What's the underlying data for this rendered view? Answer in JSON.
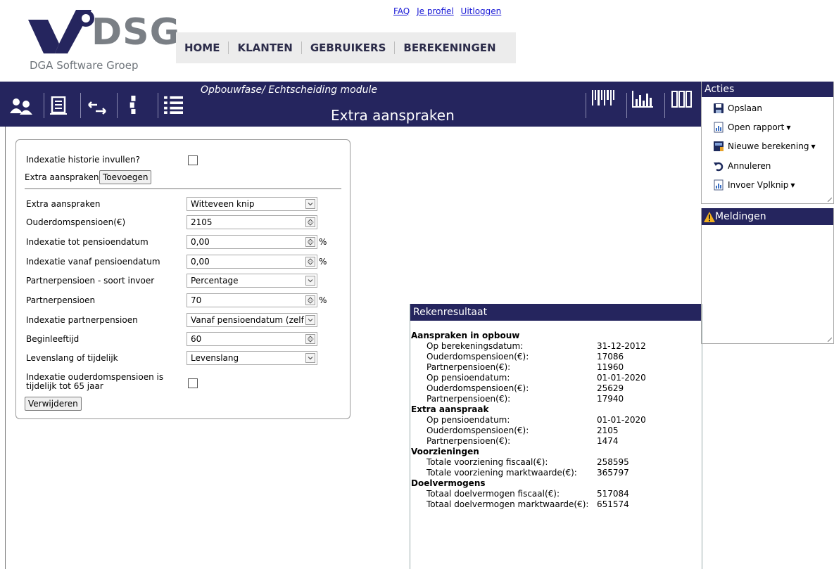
{
  "brand": {
    "logo_text": "DSG",
    "logo_subtitle": "DGA Software Groep"
  },
  "top_links": {
    "faq": "FAQ",
    "profile": "Je profiel",
    "logout": "Uitloggen"
  },
  "nav": {
    "home": "HOME",
    "clients": "KLANTEN",
    "users": "GEBRUIKERS",
    "calculations": "BEREKENINGEN"
  },
  "toolbar": {
    "module_title": "Opbouwfase/ Echtscheiding module",
    "page_title": "Extra aanspraken",
    "icons_left": [
      "users-icon",
      "document-icon",
      "arrows-icon",
      "person-icon",
      "list-icon"
    ],
    "icons_right": [
      "barcode-icon",
      "bar-chart-icon",
      "columns-icon"
    ]
  },
  "form": {
    "indexatie_historie_label": "Indexatie historie invullen?",
    "indexatie_historie_checked": false,
    "extra_aanspraken_heading": "Extra aanspraken",
    "add_button": "Toevoegen",
    "fields": [
      {
        "label": "Extra aanspraken",
        "value": "Witteveen knip",
        "type": "select"
      },
      {
        "label": "Ouderdomspensioen(€)",
        "value": "2105",
        "type": "spinner"
      },
      {
        "label": "Indexatie tot pensioendatum",
        "value": "0,00",
        "type": "spinner",
        "unit": "%"
      },
      {
        "label": "Indexatie vanaf pensioendatum",
        "value": "0,00",
        "type": "spinner",
        "unit": "%"
      },
      {
        "label": "Partnerpensioen - soort invoer",
        "value": "Percentage",
        "type": "select"
      },
      {
        "label": "Partnerpensioen",
        "value": "70",
        "type": "spinner",
        "unit": "%"
      },
      {
        "label": "Indexatie partnerpensioen",
        "value": "Vanaf pensioendatum (zelf",
        "type": "select"
      },
      {
        "label": "Beginleeftijd",
        "value": "60",
        "type": "spinner"
      },
      {
        "label": "Levenslang of tijdelijk",
        "value": "Levenslang",
        "type": "select"
      }
    ],
    "tijdelijk_label_1": "Indexatie ouderdomspensioen is",
    "tijdelijk_label_2": "tijdelijk tot 65 jaar",
    "tijdelijk_checked": false,
    "remove_button": "Verwijderen"
  },
  "result": {
    "title": "Rekenresultaat",
    "sections": [
      {
        "heading": "Aanspraken in opbouw",
        "rows": [
          {
            "label": "Op berekeningsdatum:",
            "value": "31-12-2012"
          },
          {
            "label": "Ouderdomspensioen(€):",
            "value": "17086"
          },
          {
            "label": "Partnerpensioen(€):",
            "value": "11960"
          },
          {
            "label": "Op pensioendatum:",
            "value": "01-01-2020"
          },
          {
            "label": "Ouderdomspensioen(€):",
            "value": "25629"
          },
          {
            "label": "Partnerpensioen(€):",
            "value": "17940"
          }
        ]
      },
      {
        "heading": "Extra aanspraak",
        "rows": [
          {
            "label": "Op pensioendatum:",
            "value": "01-01-2020"
          },
          {
            "label": "Ouderdomspensioen(€):",
            "value": "2105"
          },
          {
            "label": "Partnerpensioen(€):",
            "value": "1474"
          }
        ]
      },
      {
        "heading": "Voorzieningen",
        "rows": [
          {
            "label": "Totale voorziening fiscaal(€):",
            "value": "258595"
          },
          {
            "label": "Totale voorziening marktwaarde(€):",
            "value": "365797"
          }
        ]
      },
      {
        "heading": "Doelvermogens",
        "rows": [
          {
            "label": "Totaal doelvermogen fiscaal(€):",
            "value": "517084"
          },
          {
            "label": "Totaal doelvermogen marktwaarde(€):",
            "value": "651574"
          }
        ]
      }
    ]
  },
  "actions": {
    "title": "Acties",
    "items": [
      {
        "label": "Opslaan",
        "icon": "save-icon",
        "dropdown": false
      },
      {
        "label": "Open rapport",
        "icon": "report-icon",
        "dropdown": true
      },
      {
        "label": "Nieuwe berekening",
        "icon": "new-calculation-icon",
        "dropdown": true
      },
      {
        "label": "Annuleren",
        "icon": "undo-icon",
        "dropdown": false
      },
      {
        "label": "Invoer Vplknip",
        "icon": "report-icon",
        "dropdown": true
      }
    ]
  },
  "notifications": {
    "title": "Meldingen",
    "icon": "warning-icon"
  },
  "colors": {
    "header_bar": "#25255e",
    "link": "#1a1ad6",
    "nav_bg": "#ececec"
  }
}
